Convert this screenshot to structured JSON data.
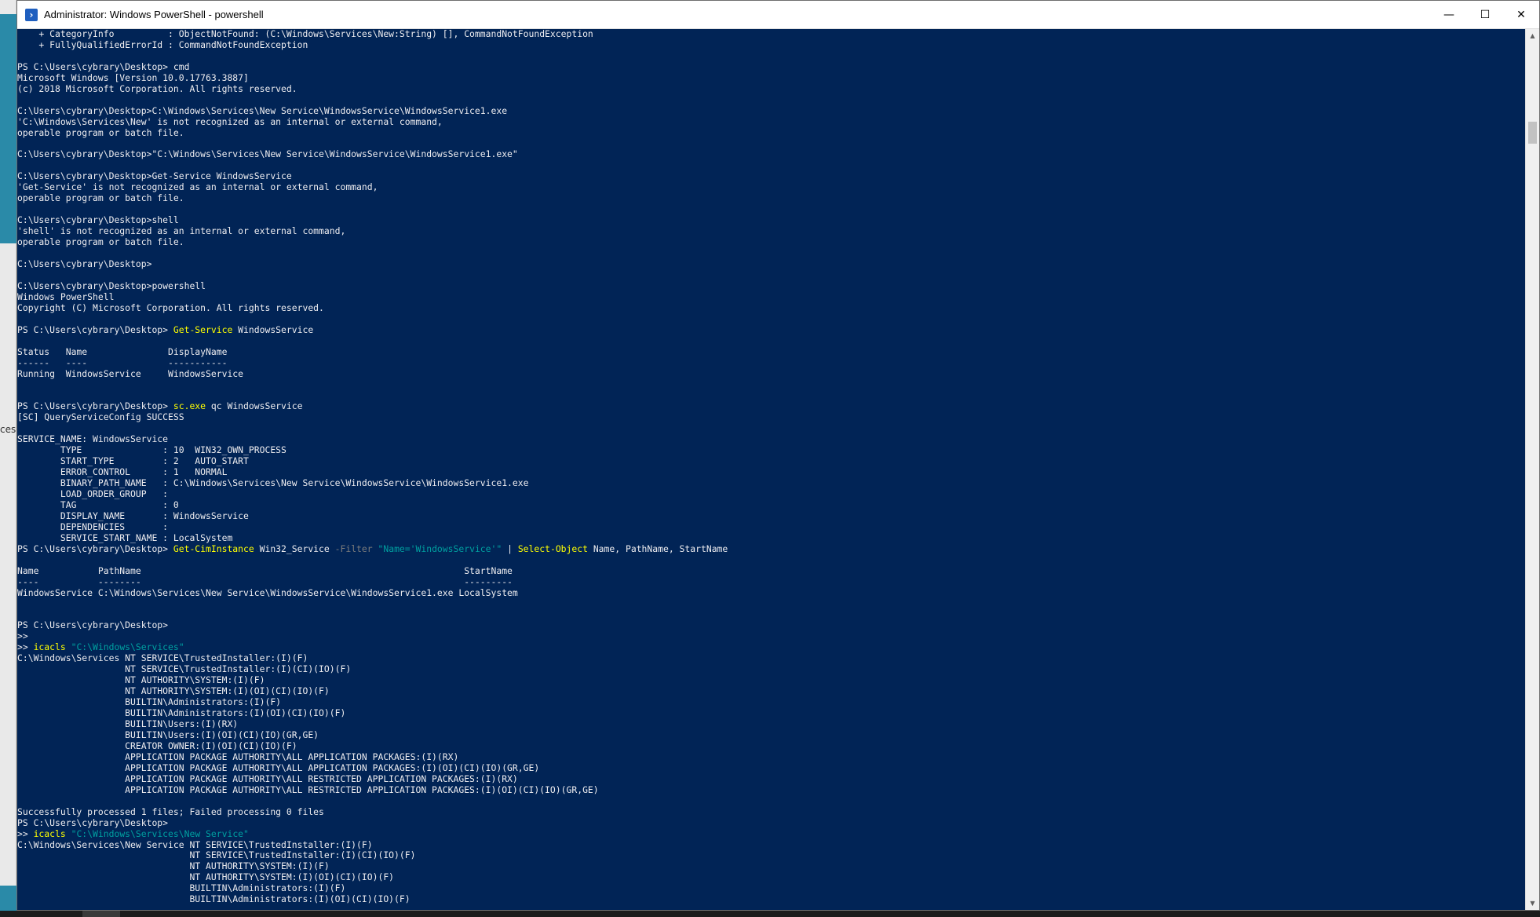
{
  "left_panel": {
    "partial_text": "ces"
  },
  "window": {
    "title": "Administrator: Windows PowerShell - powershell",
    "icon": "powershell-icon",
    "controls": {
      "minimize": "—",
      "maximize": "☐",
      "close": "✕"
    }
  },
  "colors": {
    "background": "#012456",
    "text": "#eeedf0",
    "command": "#ffff00",
    "parameter": "#7c7c7c",
    "string": "#00a0a0"
  },
  "console": {
    "lines": [
      [
        [
          "    + CategoryInfo          : ObjectNotFound: (C:\\Windows\\Services\\New:String) [], CommandNotFoundException",
          ""
        ]
      ],
      [
        [
          "    + FullyQualifiedErrorId : CommandNotFoundException",
          ""
        ]
      ],
      [
        [
          "",
          ""
        ]
      ],
      [
        [
          "PS C:\\Users\\cybrary\\Desktop> cmd",
          ""
        ]
      ],
      [
        [
          "Microsoft Windows [Version 10.0.17763.3887]",
          ""
        ]
      ],
      [
        [
          "(c) 2018 Microsoft Corporation. All rights reserved.",
          ""
        ]
      ],
      [
        [
          "",
          ""
        ]
      ],
      [
        [
          "C:\\Users\\cybrary\\Desktop>C:\\Windows\\Services\\New Service\\WindowsService\\WindowsService1.exe",
          ""
        ]
      ],
      [
        [
          "'C:\\Windows\\Services\\New' is not recognized as an internal or external command,",
          ""
        ]
      ],
      [
        [
          "operable program or batch file.",
          ""
        ]
      ],
      [
        [
          "",
          ""
        ]
      ],
      [
        [
          "C:\\Users\\cybrary\\Desktop>\"C:\\Windows\\Services\\New Service\\WindowsService\\WindowsService1.exe\"",
          ""
        ]
      ],
      [
        [
          "",
          ""
        ]
      ],
      [
        [
          "C:\\Users\\cybrary\\Desktop>Get-Service WindowsService",
          ""
        ]
      ],
      [
        [
          "'Get-Service' is not recognized as an internal or external command,",
          ""
        ]
      ],
      [
        [
          "operable program or batch file.",
          ""
        ]
      ],
      [
        [
          "",
          ""
        ]
      ],
      [
        [
          "C:\\Users\\cybrary\\Desktop>shell",
          ""
        ]
      ],
      [
        [
          "'shell' is not recognized as an internal or external command,",
          ""
        ]
      ],
      [
        [
          "operable program or batch file.",
          ""
        ]
      ],
      [
        [
          "",
          ""
        ]
      ],
      [
        [
          "C:\\Users\\cybrary\\Desktop>",
          ""
        ]
      ],
      [
        [
          "",
          ""
        ]
      ],
      [
        [
          "C:\\Users\\cybrary\\Desktop>powershell",
          ""
        ]
      ],
      [
        [
          "Windows PowerShell",
          ""
        ]
      ],
      [
        [
          "Copyright (C) Microsoft Corporation. All rights reserved.",
          ""
        ]
      ],
      [
        [
          "",
          ""
        ]
      ],
      [
        [
          "PS C:\\Users\\cybrary\\Desktop> ",
          ""
        ],
        [
          "Get-Service",
          "cmd"
        ],
        [
          " WindowsService",
          ""
        ]
      ],
      [
        [
          "",
          ""
        ]
      ],
      [
        [
          "Status   Name               DisplayName",
          ""
        ]
      ],
      [
        [
          "------   ----               -----------",
          ""
        ]
      ],
      [
        [
          "Running  WindowsService     WindowsService",
          ""
        ]
      ],
      [
        [
          "",
          ""
        ]
      ],
      [
        [
          "",
          ""
        ]
      ],
      [
        [
          "PS C:\\Users\\cybrary\\Desktop> ",
          ""
        ],
        [
          "sc.exe",
          "cmd"
        ],
        [
          " qc WindowsService",
          ""
        ]
      ],
      [
        [
          "[SC] QueryServiceConfig SUCCESS",
          ""
        ]
      ],
      [
        [
          "",
          ""
        ]
      ],
      [
        [
          "SERVICE_NAME: WindowsService",
          ""
        ]
      ],
      [
        [
          "        TYPE               : 10  WIN32_OWN_PROCESS",
          ""
        ]
      ],
      [
        [
          "        START_TYPE         : 2   AUTO_START",
          ""
        ]
      ],
      [
        [
          "        ERROR_CONTROL      : 1   NORMAL",
          ""
        ]
      ],
      [
        [
          "        BINARY_PATH_NAME   : C:\\Windows\\Services\\New Service\\WindowsService\\WindowsService1.exe",
          ""
        ]
      ],
      [
        [
          "        LOAD_ORDER_GROUP   :",
          ""
        ]
      ],
      [
        [
          "        TAG                : 0",
          ""
        ]
      ],
      [
        [
          "        DISPLAY_NAME       : WindowsService",
          ""
        ]
      ],
      [
        [
          "        DEPENDENCIES       :",
          ""
        ]
      ],
      [
        [
          "        SERVICE_START_NAME : LocalSystem",
          ""
        ]
      ],
      [
        [
          "PS C:\\Users\\cybrary\\Desktop> ",
          ""
        ],
        [
          "Get-CimInstance",
          "cmd"
        ],
        [
          " Win32_Service ",
          ""
        ],
        [
          "-Filter",
          "param"
        ],
        [
          " ",
          ""
        ],
        [
          "\"Name='WindowsService'\"",
          "str"
        ],
        [
          " | ",
          ""
        ],
        [
          "Select-Object",
          "cmd"
        ],
        [
          " Name, PathName, StartName",
          ""
        ]
      ],
      [
        [
          "",
          ""
        ]
      ],
      [
        [
          "Name           PathName                                                            StartName",
          ""
        ]
      ],
      [
        [
          "----           --------                                                            ---------",
          ""
        ]
      ],
      [
        [
          "WindowsService C:\\Windows\\Services\\New Service\\WindowsService\\WindowsService1.exe LocalSystem",
          ""
        ]
      ],
      [
        [
          "",
          ""
        ]
      ],
      [
        [
          "",
          ""
        ]
      ],
      [
        [
          "PS C:\\Users\\cybrary\\Desktop>",
          ""
        ]
      ],
      [
        [
          ">>",
          ""
        ]
      ],
      [
        [
          ">> ",
          ""
        ],
        [
          "icacls",
          "cmd"
        ],
        [
          " ",
          ""
        ],
        [
          "\"C:\\Windows\\Services\"",
          "str"
        ]
      ],
      [
        [
          "C:\\Windows\\Services NT SERVICE\\TrustedInstaller:(I)(F)",
          ""
        ]
      ],
      [
        [
          "                    NT SERVICE\\TrustedInstaller:(I)(CI)(IO)(F)",
          ""
        ]
      ],
      [
        [
          "                    NT AUTHORITY\\SYSTEM:(I)(F)",
          ""
        ]
      ],
      [
        [
          "                    NT AUTHORITY\\SYSTEM:(I)(OI)(CI)(IO)(F)",
          ""
        ]
      ],
      [
        [
          "                    BUILTIN\\Administrators:(I)(F)",
          ""
        ]
      ],
      [
        [
          "                    BUILTIN\\Administrators:(I)(OI)(CI)(IO)(F)",
          ""
        ]
      ],
      [
        [
          "                    BUILTIN\\Users:(I)(RX)",
          ""
        ]
      ],
      [
        [
          "                    BUILTIN\\Users:(I)(OI)(CI)(IO)(GR,GE)",
          ""
        ]
      ],
      [
        [
          "                    CREATOR OWNER:(I)(OI)(CI)(IO)(F)",
          ""
        ]
      ],
      [
        [
          "                    APPLICATION PACKAGE AUTHORITY\\ALL APPLICATION PACKAGES:(I)(RX)",
          ""
        ]
      ],
      [
        [
          "                    APPLICATION PACKAGE AUTHORITY\\ALL APPLICATION PACKAGES:(I)(OI)(CI)(IO)(GR,GE)",
          ""
        ]
      ],
      [
        [
          "                    APPLICATION PACKAGE AUTHORITY\\ALL RESTRICTED APPLICATION PACKAGES:(I)(RX)",
          ""
        ]
      ],
      [
        [
          "                    APPLICATION PACKAGE AUTHORITY\\ALL RESTRICTED APPLICATION PACKAGES:(I)(OI)(CI)(IO)(GR,GE)",
          ""
        ]
      ],
      [
        [
          "",
          ""
        ]
      ],
      [
        [
          "Successfully processed 1 files; Failed processing 0 files",
          ""
        ]
      ],
      [
        [
          "PS C:\\Users\\cybrary\\Desktop>",
          ""
        ]
      ],
      [
        [
          ">> ",
          ""
        ],
        [
          "icacls",
          "cmd"
        ],
        [
          " ",
          ""
        ],
        [
          "\"C:\\Windows\\Services\\New Service\"",
          "str"
        ]
      ],
      [
        [
          "C:\\Windows\\Services\\New Service NT SERVICE\\TrustedInstaller:(I)(F)",
          ""
        ]
      ],
      [
        [
          "                                NT SERVICE\\TrustedInstaller:(I)(CI)(IO)(F)",
          ""
        ]
      ],
      [
        [
          "                                NT AUTHORITY\\SYSTEM:(I)(F)",
          ""
        ]
      ],
      [
        [
          "                                NT AUTHORITY\\SYSTEM:(I)(OI)(CI)(IO)(F)",
          ""
        ]
      ],
      [
        [
          "                                BUILTIN\\Administrators:(I)(F)",
          ""
        ]
      ],
      [
        [
          "                                BUILTIN\\Administrators:(I)(OI)(CI)(IO)(F)",
          ""
        ]
      ]
    ]
  },
  "scrollbar": {
    "up_icon": "▲",
    "down_icon": "▼"
  }
}
